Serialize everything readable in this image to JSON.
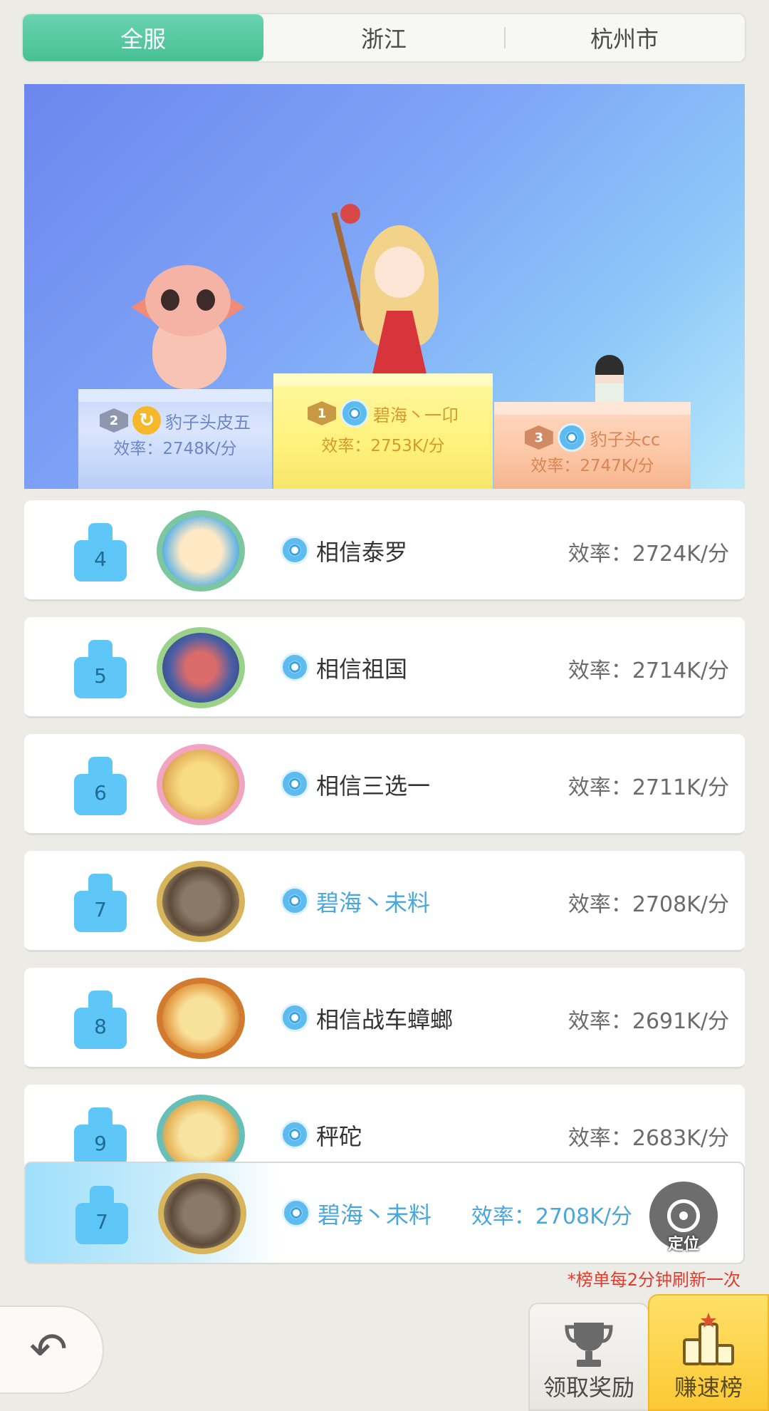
{
  "tabs": [
    {
      "label": "全服",
      "active": true
    },
    {
      "label": "浙江",
      "active": false
    },
    {
      "label": "杭州市",
      "active": false
    }
  ],
  "podium": {
    "first": {
      "rank": "1",
      "name": "碧海丶一卬",
      "efficiency": "效率：2753K/分"
    },
    "second": {
      "rank": "2",
      "name": "豹子头皮五",
      "efficiency": "效率：2748K/分"
    },
    "third": {
      "rank": "3",
      "name": "豹子头cc",
      "efficiency": "效率：2747K/分"
    }
  },
  "rows": [
    {
      "rank": "4",
      "name": "相信泰罗",
      "efficiency": "效率：2724K/分"
    },
    {
      "rank": "5",
      "name": "相信祖国",
      "efficiency": "效率：2714K/分"
    },
    {
      "rank": "6",
      "name": "相信三选一",
      "efficiency": "效率：2711K/分"
    },
    {
      "rank": "7",
      "name": "碧海丶未料",
      "efficiency": "效率：2708K/分"
    },
    {
      "rank": "8",
      "name": "相信战车蟑螂",
      "efficiency": "效率：2691K/分"
    },
    {
      "rank": "9",
      "name": "秤砣",
      "efficiency": "效率：2683K/分"
    }
  ],
  "self_row": {
    "rank": "7",
    "name": "碧海丶未料",
    "efficiency": "效率：2708K/分",
    "locate_label": "定位"
  },
  "refresh_note": "*榜单每2分钟刷新一次",
  "bottom_bar": {
    "back_icon": "back-arrow-icon",
    "reward_label": "领取奖励",
    "ranking_label": "赚速榜"
  },
  "colors": {
    "tab_active": "#47c095",
    "self_name": "#4aa6dc",
    "note": "#e13c2e",
    "ranking_button": "#fbc935"
  }
}
